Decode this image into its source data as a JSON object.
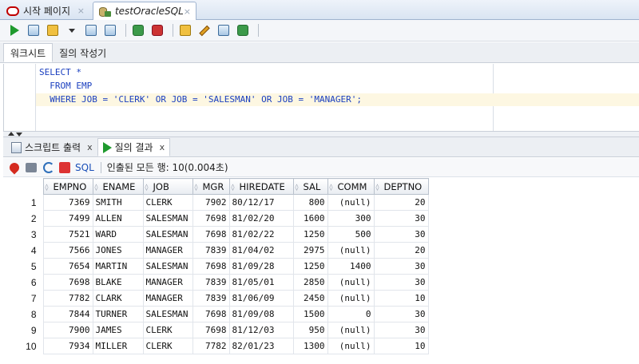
{
  "doc_tabs": [
    {
      "label": "시작 페이지",
      "close": "×"
    },
    {
      "label": "testOracleSQL",
      "close": "×"
    }
  ],
  "subtabs": {
    "worksheet": "워크시트",
    "query_builder": "질의 작성기"
  },
  "editor": {
    "lines": [
      "SELECT *",
      "  FROM EMP",
      "  WHERE JOB = 'CLERK' OR JOB = 'SALESMAN' OR JOB = 'MANAGER';"
    ]
  },
  "output_tabs": {
    "script_output": "스크립트 출력",
    "query_result": "질의 결과",
    "close": "x"
  },
  "results_toolbar": {
    "sql_link": "SQL",
    "status": "인출된 모든 행: 10(0.004초)"
  },
  "grid": {
    "columns": [
      "EMPNO",
      "ENAME",
      "JOB",
      "MGR",
      "HIREDATE",
      "SAL",
      "COMM",
      "DEPTNO"
    ],
    "rows": [
      [
        "1",
        "7369",
        "SMITH",
        "CLERK",
        "7902",
        "80/12/17",
        "800",
        "(null)",
        "20"
      ],
      [
        "2",
        "7499",
        "ALLEN",
        "SALESMAN",
        "7698",
        "81/02/20",
        "1600",
        "300",
        "30"
      ],
      [
        "3",
        "7521",
        "WARD",
        "SALESMAN",
        "7698",
        "81/02/22",
        "1250",
        "500",
        "30"
      ],
      [
        "4",
        "7566",
        "JONES",
        "MANAGER",
        "7839",
        "81/04/02",
        "2975",
        "(null)",
        "20"
      ],
      [
        "5",
        "7654",
        "MARTIN",
        "SALESMAN",
        "7698",
        "81/09/28",
        "1250",
        "1400",
        "30"
      ],
      [
        "6",
        "7698",
        "BLAKE",
        "MANAGER",
        "7839",
        "81/05/01",
        "2850",
        "(null)",
        "30"
      ],
      [
        "7",
        "7782",
        "CLARK",
        "MANAGER",
        "7839",
        "81/06/09",
        "2450",
        "(null)",
        "10"
      ],
      [
        "8",
        "7844",
        "TURNER",
        "SALESMAN",
        "7698",
        "81/09/08",
        "1500",
        "0",
        "30"
      ],
      [
        "9",
        "7900",
        "JAMES",
        "CLERK",
        "7698",
        "81/12/03",
        "950",
        "(null)",
        "30"
      ],
      [
        "10",
        "7934",
        "MILLER",
        "CLERK",
        "7782",
        "82/01/23",
        "1300",
        "(null)",
        "10"
      ]
    ]
  },
  "colors": {
    "run_green": "#1f9a2e",
    "keyword_blue": "#1a3fbf",
    "current_line": "#fdf7e2"
  }
}
